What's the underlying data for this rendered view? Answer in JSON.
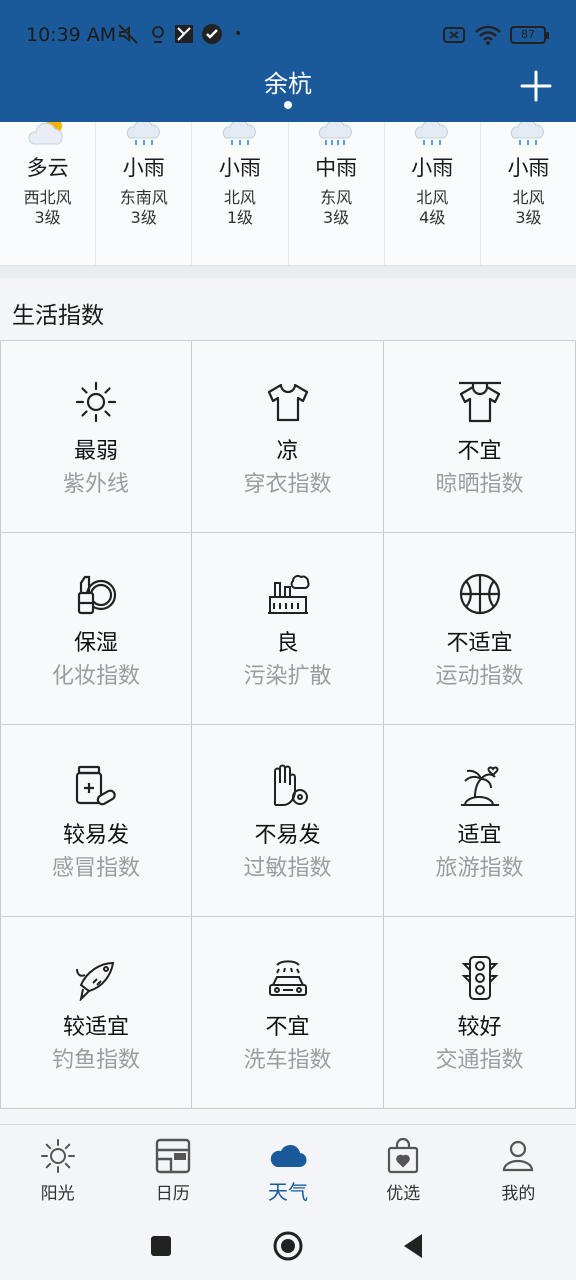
{
  "status_bar": {
    "time": "10:39 AM",
    "battery": "87"
  },
  "header": {
    "city": "余杭"
  },
  "forecast": [
    {
      "condition": "多云",
      "wind": "西北风",
      "level": "3级",
      "icon": "partly-cloudy-icon"
    },
    {
      "condition": "小雨",
      "wind": "东南风",
      "level": "3级",
      "icon": "light-rain-icon"
    },
    {
      "condition": "小雨",
      "wind": "北风",
      "level": "1级",
      "icon": "light-rain-icon"
    },
    {
      "condition": "中雨",
      "wind": "东风",
      "level": "3级",
      "icon": "moderate-rain-icon"
    },
    {
      "condition": "小雨",
      "wind": "北风",
      "level": "4级",
      "icon": "light-rain-icon"
    },
    {
      "condition": "小雨",
      "wind": "北风",
      "level": "3级",
      "icon": "light-rain-icon"
    }
  ],
  "life_index": {
    "title": "生活指数",
    "items": [
      {
        "value": "最弱",
        "name": "紫外线",
        "icon": "sun-icon"
      },
      {
        "value": "凉",
        "name": "穿衣指数",
        "icon": "tshirt-icon"
      },
      {
        "value": "不宜",
        "name": "晾晒指数",
        "icon": "drying-clothes-icon"
      },
      {
        "value": "保湿",
        "name": "化妆指数",
        "icon": "cosmetics-icon"
      },
      {
        "value": "良",
        "name": "污染扩散",
        "icon": "factory-icon"
      },
      {
        "value": "不适宜",
        "name": "运动指数",
        "icon": "basketball-icon"
      },
      {
        "value": "较易发",
        "name": "感冒指数",
        "icon": "medicine-icon"
      },
      {
        "value": "不易发",
        "name": "过敏指数",
        "icon": "allergy-hand-icon"
      },
      {
        "value": "适宜",
        "name": "旅游指数",
        "icon": "palm-island-icon"
      },
      {
        "value": "较适宜",
        "name": "钓鱼指数",
        "icon": "fish-hook-icon"
      },
      {
        "value": "不宜",
        "name": "洗车指数",
        "icon": "car-wash-icon"
      },
      {
        "value": "较好",
        "name": "交通指数",
        "icon": "traffic-light-icon"
      }
    ]
  },
  "bottom_nav": [
    {
      "label": "阳光",
      "icon": "sun-icon"
    },
    {
      "label": "日历",
      "icon": "calendar-icon"
    },
    {
      "label": "天气",
      "icon": "cloud-icon",
      "active": true
    },
    {
      "label": "优选",
      "icon": "shopping-bag-icon"
    },
    {
      "label": "我的",
      "icon": "profile-icon"
    }
  ],
  "colors": {
    "header_bg": "#1b5a9a",
    "active_tab": "#1b5a9a",
    "muted_text": "#9a9da3"
  }
}
